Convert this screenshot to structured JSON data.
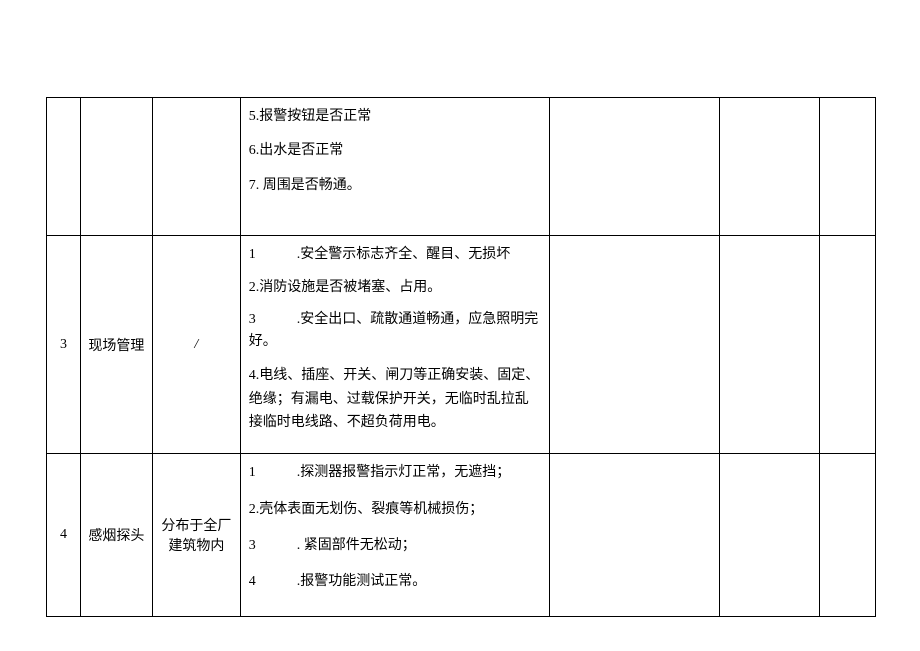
{
  "table": {
    "rows": [
      {
        "num": "",
        "category": "",
        "location": "",
        "content_lines": [
          "5.报警按钮是否正常",
          "6.出水是否正常",
          "7. 周围是否畅通。"
        ]
      },
      {
        "num": "3",
        "category": "现场管理",
        "location": "/",
        "content_lines": [
          {
            "prefix": "1",
            "gap": true,
            "text": ".安全警示标志齐全、醒目、无损坏"
          },
          {
            "prefix": "",
            "gap": false,
            "text": "2.消防设施是否被堵塞、占用。"
          },
          {
            "prefix": "3",
            "gap": true,
            "text": ".安全出口、疏散通道畅通，应急照明完好。"
          },
          {
            "prefix": "",
            "gap": false,
            "text": "4.电线、插座、开关、闸刀等正确安装、固定、绝缘；有漏电、过载保护开关，无临时乱拉乱接临时电线路、不超负荷用电。"
          }
        ]
      },
      {
        "num": "4",
        "category": "感烟探头",
        "location": "分布于全厂建筑物内",
        "content_lines": [
          {
            "prefix": "1",
            "gap": true,
            "text": ".探测器报警指示灯正常，无遮挡；"
          },
          {
            "prefix": "",
            "gap": false,
            "text": "2.壳体表面无划伤、裂痕等机械损伤；"
          },
          {
            "prefix": "3",
            "gap": true,
            "text": ". 紧固部件无松动；"
          },
          {
            "prefix": "4",
            "gap": true,
            "text": ".报警功能测试正常。"
          }
        ]
      }
    ]
  }
}
